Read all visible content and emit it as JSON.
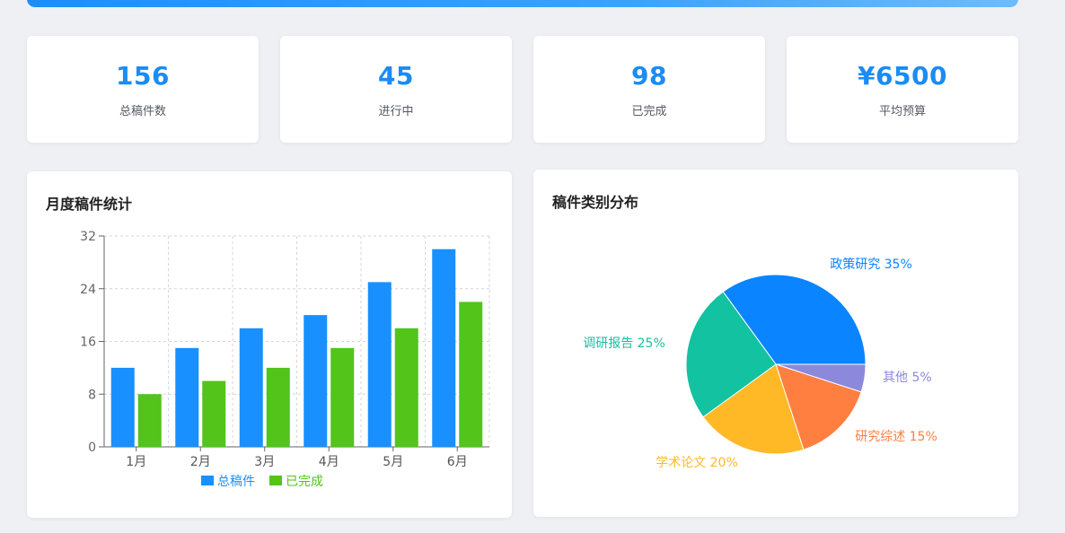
{
  "colors": {
    "accent": "#1a8cf4",
    "total": "#1890ff",
    "done": "#52c41a"
  },
  "stats": [
    {
      "value": "156",
      "label": "总稿件数"
    },
    {
      "value": "45",
      "label": "进行中"
    },
    {
      "value": "98",
      "label": "已完成"
    },
    {
      "value": "¥6500",
      "label": "平均预算"
    }
  ],
  "bar_panel": {
    "title": "月度稿件统计"
  },
  "pie_panel": {
    "title": "稿件类别分布"
  },
  "chart_data": [
    {
      "type": "bar",
      "title": "月度稿件统计",
      "categories": [
        "1月",
        "2月",
        "3月",
        "4月",
        "5月",
        "6月"
      ],
      "series": [
        {
          "name": "总稿件",
          "color": "#1890ff",
          "values": [
            12,
            15,
            18,
            20,
            25,
            30
          ]
        },
        {
          "name": "已完成",
          "color": "#52c41a",
          "values": [
            8,
            10,
            12,
            15,
            18,
            22
          ]
        }
      ],
      "ylim": [
        0,
        32
      ],
      "yticks": [
        0,
        8,
        16,
        24,
        32
      ],
      "grid": true,
      "legend": "bottom"
    },
    {
      "type": "pie",
      "title": "稿件类别分布",
      "slices": [
        {
          "label": "政策研究 35%",
          "value": 35,
          "color": "#0a84ff"
        },
        {
          "label": "其他 5%",
          "value": 5,
          "color": "#8c88dc"
        },
        {
          "label": "研究综述 15%",
          "value": 15,
          "color": "#ff7f41"
        },
        {
          "label": "学术论文 20%",
          "value": 20,
          "color": "#ffb927"
        },
        {
          "label": "调研报告 25%",
          "value": 25,
          "color": "#12c2a0"
        }
      ],
      "legend": "none"
    }
  ]
}
